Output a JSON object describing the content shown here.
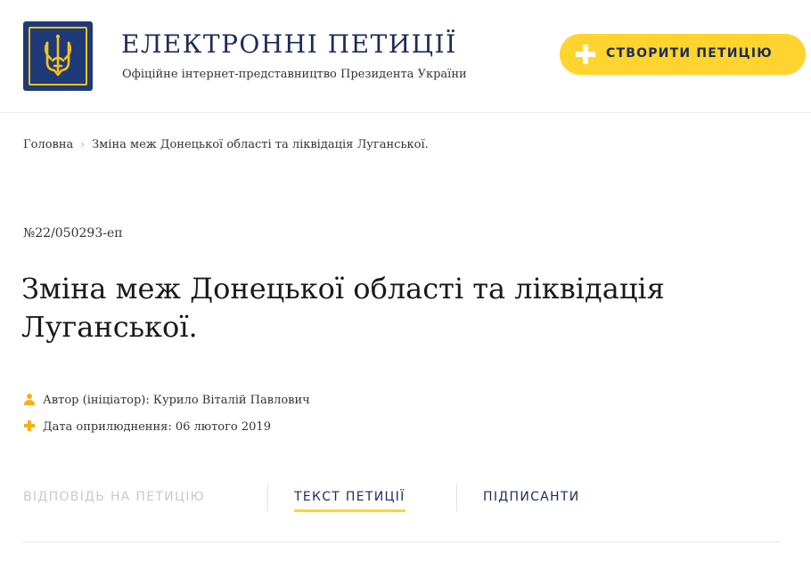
{
  "header": {
    "title": "ЕЛЕКТРОННІ ПЕТИЦІЇ",
    "subtitle": "Офіційне інтернет-представництво Президента України",
    "create_button_label": "СТВОРИТИ ПЕТИЦІЮ",
    "logo_icon": "trident-coat-of-arms-icon"
  },
  "breadcrumb": {
    "home": "Головна",
    "separator": "›",
    "current": "Зміна меж Донецької області та ліквідація Луганської."
  },
  "petition": {
    "number": "№22/050293-еп",
    "title": "Зміна меж Донецької області та ліквідація Луганської.",
    "author": "Автор (ініціатор): Курило Віталій Павлович",
    "date": "Дата оприлюднення: 06 лютого 2019"
  },
  "tabs": {
    "response": "ВІДПОВІДЬ НА ПЕТИЦІЮ",
    "text": "ТЕКСТ ПЕТИЦІЇ",
    "signers": "ПІДПИСАНТИ"
  },
  "colors": {
    "accent": "#ffd42e",
    "brand_blue": "#1f3a78",
    "muted_tab": "#c9c9c9"
  }
}
